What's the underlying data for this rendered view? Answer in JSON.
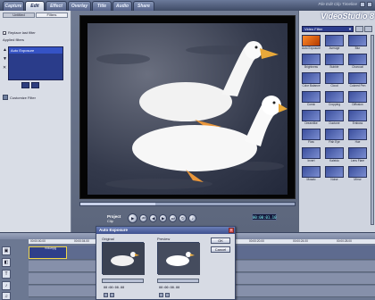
{
  "app": {
    "title": "VideoStudio 8",
    "menu_right": "File Edit Clip Timeline"
  },
  "steps": [
    {
      "label": "Capture"
    },
    {
      "label": "Edit"
    },
    {
      "label": "Effect"
    },
    {
      "label": "Overlay"
    },
    {
      "label": "Title"
    },
    {
      "label": "Audio"
    },
    {
      "label": "Share"
    }
  ],
  "options_panel": {
    "tabs": [
      "Untitled",
      "Filters"
    ],
    "replace_label": "Replace last filter",
    "applied_label": "Applied filters",
    "applied_item": "Auto Exposure",
    "customize_label": "Customize Filter"
  },
  "player": {
    "project_label": "Project",
    "clip_label": "Clip",
    "buttons": [
      "prev",
      "play",
      "stop",
      "back",
      "fwd",
      "end",
      "loop",
      "vol"
    ],
    "timecode": "00:00:01.10"
  },
  "library": {
    "dropdown": "Video Filter",
    "items": [
      "Auto Exposure",
      "Average",
      "Blur",
      "Brightness",
      "Bubble",
      "Charcoal",
      "Color Balance",
      "Cloud",
      "Colored Pen",
      "Comic",
      "Cropping",
      "Diffusion",
      "Dreamlike",
      "Duotone",
      "Emboss",
      "Flow",
      "Fish Eye",
      "Hue",
      "Invert",
      "Kaleido",
      "Lens Flare",
      "Mosaic",
      "Noise",
      "Mirror"
    ],
    "selected_index": 0
  },
  "timeline": {
    "ruler": [
      "00:00:00.00",
      "00:00:04.00",
      "00:00:08.00",
      "00:00:12.00",
      "00:00:16.00",
      "00:00:20.00",
      "00:00:24.00",
      "00:00:28.00"
    ],
    "clip_name": "V06.mpg",
    "track_icons": [
      "video-track-icon",
      "overlay-track-icon",
      "title-track-icon",
      "voice-track-icon",
      "music-track-icon"
    ]
  },
  "dialog": {
    "title": "Auto Exposure",
    "original_label": "Original",
    "preview_label": "Preview",
    "ok_label": "OK",
    "cancel_label": "Cancel",
    "original_time": "00:00:00.00",
    "preview_time": "00:00:00.00"
  }
}
